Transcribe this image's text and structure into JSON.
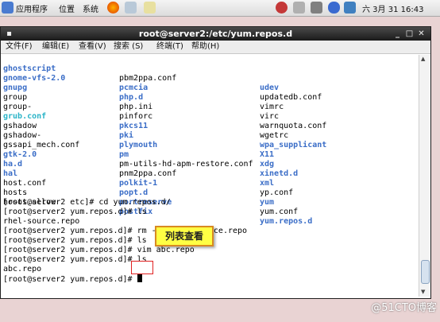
{
  "panel": {
    "apps": "应用程序",
    "places": "位置",
    "system": "系统",
    "clock": "六 3月 31 16:43"
  },
  "window": {
    "title": "root@server2:/etc/yum.repos.d",
    "menu": [
      "文件(F)",
      "编辑(E)",
      "查看(V)",
      "搜索 (S)",
      "终端(T)",
      "帮助(H)"
    ]
  },
  "listing": [
    [
      "ghostscript",
      "pbm2ppa.conf",
      "udev"
    ],
    [
      "gnome-vfs-2.0",
      "pcmcia",
      "updatedb.conf"
    ],
    [
      "gnupg",
      "php.d",
      "vimrc"
    ],
    [
      "group",
      "php.ini",
      "virc"
    ],
    [
      "group-",
      "pinforc",
      "warnquota.conf"
    ],
    [
      "grub.conf",
      "pkcs11",
      "wgetrc"
    ],
    [
      "gshadow",
      "pki",
      "wpa_supplicant"
    ],
    [
      "gshadow-",
      "plymouth",
      "X11"
    ],
    [
      "gssapi_mech.conf",
      "pm",
      "xdg"
    ],
    [
      "gtk-2.0",
      "pm-utils-hd-apm-restore.conf",
      "xinetd.d"
    ],
    [
      "ha.d",
      "pnm2ppa.conf",
      "xml"
    ],
    [
      "hal",
      "polkit-1",
      "yp.conf"
    ],
    [
      "host.conf",
      "popt.d",
      "yum"
    ],
    [
      "hosts",
      "portreserve",
      "yum.conf"
    ],
    [
      "hosts.allow",
      "postfix",
      "yum.repos.d"
    ]
  ],
  "session": [
    "[root@server2 etc]# cd yum.repos.d/",
    "[root@server2 yum.repos.d]# ls",
    "rhel-source.repo",
    "[root@server2 yum.repos.d]# rm -rf rhel-source.repo",
    "[root@server2 yum.repos.d]# ls",
    "[root@server2 yum.repos.d]# vim abc.repo",
    "[root@server2 yum.repos.d]# ls",
    "abc.repo",
    "[root@server2 yum.repos.d]# "
  ],
  "annotation": "列表查看",
  "watermark": "@51CTO博客"
}
